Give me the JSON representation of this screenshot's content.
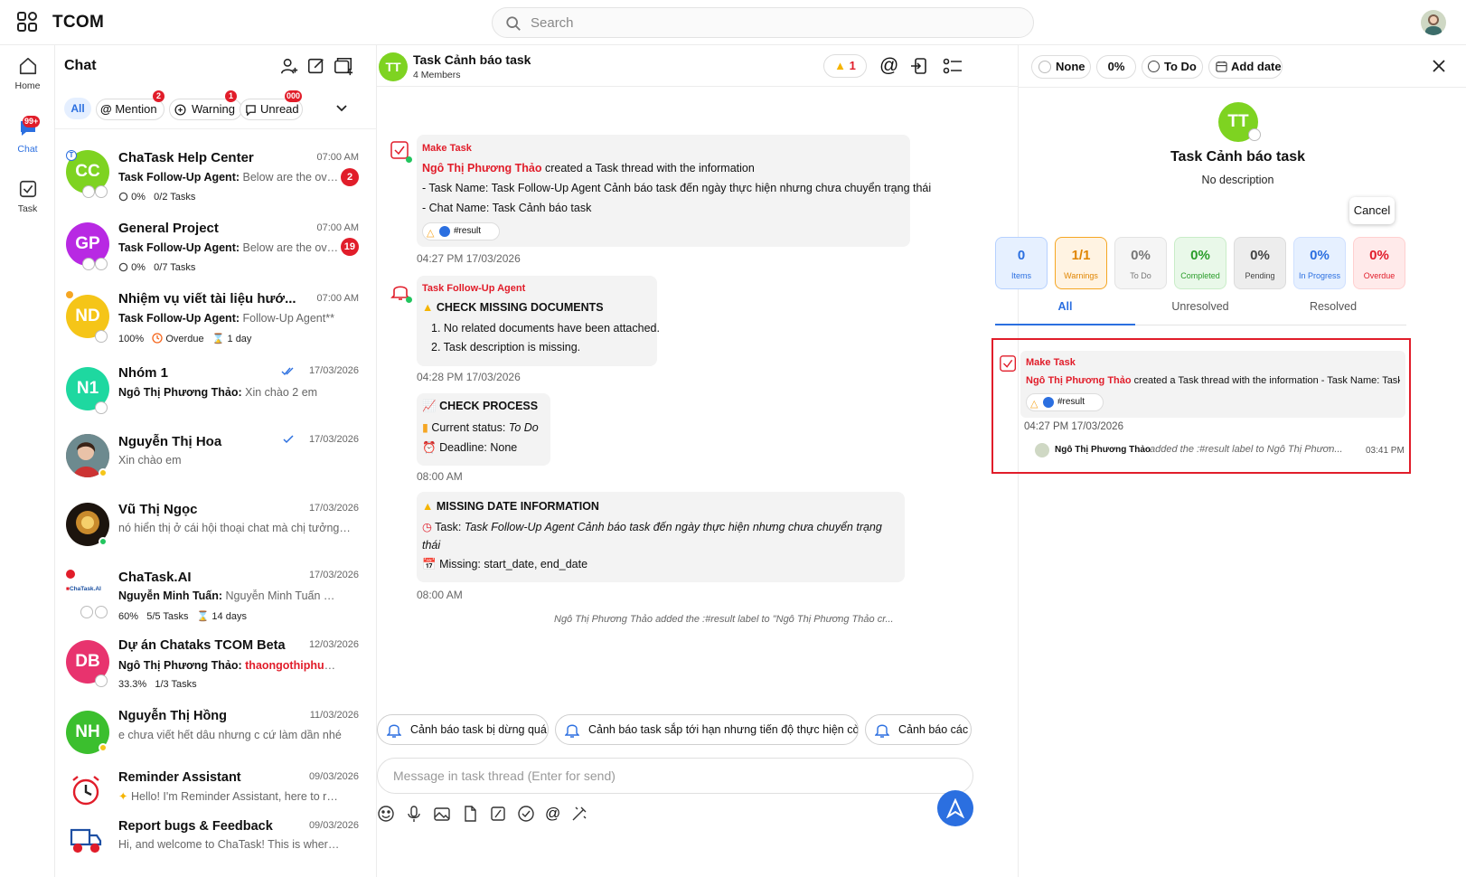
{
  "app": {
    "name": "TCOM"
  },
  "search": {
    "placeholder": "Search"
  },
  "rail": {
    "home": "Home",
    "chat": "Chat",
    "chat_badge": "99+",
    "task": "Task"
  },
  "chatlist": {
    "title": "Chat",
    "filters": {
      "all": "All",
      "mention": "Mention",
      "mention_badge": "2",
      "warning": "Warning",
      "warning_badge": "1",
      "unread": "Unread",
      "unread_badge": "000"
    },
    "items": [
      {
        "initials": "CC",
        "name": "ChaTask Help Center",
        "time": "07:00 AM",
        "sender": "Task Follow-Up Agent:",
        "preview": " Below are the over...",
        "unread": "2",
        "progress": "0%",
        "tasks": "0/2 Tasks",
        "color": "#7ed321"
      },
      {
        "initials": "GP",
        "name": "General Project",
        "time": "07:00 AM",
        "sender": "Task Follow-Up Agent:",
        "preview": " Below are the over...",
        "unread": "19",
        "progress": "0%",
        "tasks": "0/7 Tasks",
        "color": "#b829e3"
      },
      {
        "initials": "ND",
        "name": "Nhiệm vụ viết tài liệu hướ...",
        "time": "07:00 AM",
        "sender": "Task Follow-Up Agent:",
        "preview": " Follow-Up Agent**",
        "progress": "100%",
        "status": "Overdue",
        "duration": "1 day",
        "color": "#f5c518"
      },
      {
        "initials": "N1",
        "name": "Nhóm 1",
        "time": "17/03/2026",
        "sender": "Ngô Thị Phương Thảo:",
        "preview": " Xin chào 2 em",
        "color": "#1ed8a0"
      },
      {
        "name": "Nguyễn Thị Hoa",
        "time": "17/03/2026",
        "preview": "Xin chào em"
      },
      {
        "name": "Vũ Thị Ngọc",
        "time": "17/03/2026",
        "preview": "nó hiển thị ở cái hội thoại chat mà chị tưởng tác..."
      },
      {
        "name": "ChaTask.AI",
        "time": "17/03/2026",
        "sender": "Nguyễn Minh Tuấn:",
        "preview": " Nguyễn Minh Tuấn updat...",
        "progress": "60%",
        "tasks": "5/5 Tasks",
        "duration": "14 days",
        "logo_text": "ChaTask.AI"
      },
      {
        "initials": "DB",
        "name": "Dự án Chataks TCOM Beta",
        "time": "12/03/2026",
        "sender": "Ngô Thị Phương Thảo:",
        "preview_red": " thaongothiphuong@...",
        "progress": "33.3%",
        "tasks": "1/3 Tasks",
        "color": "#e8336e"
      },
      {
        "initials": "NH",
        "name": "Nguyễn Thị Hồng",
        "time": "11/03/2026",
        "preview": "e chưa viết hết dâu nhưng c cứ làm dần nhé",
        "color": "#3bbf2e"
      },
      {
        "name": "Reminder Assistant",
        "time": "09/03/2026",
        "preview": "Hello! I'm Reminder Assistant, here to remi..."
      },
      {
        "name": "Report bugs & Feedback",
        "time": "09/03/2026",
        "preview": "Hi, and welcome to ChaTask! This is where you ..."
      }
    ]
  },
  "thread": {
    "initials": "TT",
    "title": "Task Cảnh báo task",
    "members": "4 Members",
    "warning_count": "1",
    "messages": {
      "m1": {
        "sender": "Make Task",
        "author": "Ngô Thị Phương Thảo",
        "text": " created a Task thread with the information",
        "line1": "- Task Name: Task Follow-Up Agent Cảnh báo task đến ngày thực hiện nhưng chưa chuyển trạng thái",
        "line2": "- Chat Name: Task Cảnh báo task",
        "label": "#result",
        "time": "04:27 PM 17/03/2026"
      },
      "m2": {
        "sender": "Task Follow-Up Agent",
        "heading": "CHECK MISSING DOCUMENTS",
        "item1": "1. No related documents have been attached.",
        "item2": "2. Task description is missing.",
        "time": "04:28 PM 17/03/2026"
      },
      "m3": {
        "heading": "CHECK PROCESS",
        "status_label": "Current status: ",
        "status_value": "To Do",
        "deadline": "Deadline: None",
        "time": "08:00 AM"
      },
      "m4": {
        "heading": "MISSING DATE INFORMATION",
        "task_label": "Task: ",
        "task_value": "Task Follow-Up Agent Cảnh báo task đến ngày thực hiện nhưng chưa chuyển trạng",
        "task_value2": "thái",
        "missing": "Missing: start_date, end_date",
        "time": "08:00 AM"
      },
      "system": "Ngô Thị Phương Thảo added the :#result label to \"Ngô Thị Phương Thảo cr..."
    },
    "suggestions": [
      "Cảnh báo task bị dừng quá lâu",
      "Cảnh báo task sắp tới hạn nhưng tiến độ thực hiện còn thấp",
      "Cảnh báo các w"
    ],
    "composer_placeholder": "Message in task thread (Enter for send)"
  },
  "details": {
    "priority": "None",
    "progress": "0%",
    "status": "To Do",
    "add_date": "Add date",
    "initials": "TT",
    "title": "Task Cảnh báo task",
    "description": "No description",
    "cancel": "Cancel",
    "stats": [
      {
        "value": "0",
        "label": "Items"
      },
      {
        "value": "1/1",
        "label": "Warnings"
      },
      {
        "value": "0%",
        "label": "To Do"
      },
      {
        "value": "0%",
        "label": "Completed"
      },
      {
        "value": "0%",
        "label": "Pending"
      },
      {
        "value": "0%",
        "label": "In Progress"
      },
      {
        "value": "0%",
        "label": "Overdue"
      }
    ],
    "tabs": [
      "All",
      "Unresolved",
      "Resolved"
    ],
    "card": {
      "sender": "Make Task",
      "author": "Ngô Thị Phương Thảo",
      "text": " created a Task thread with the information - Task Name: Task Follow...",
      "label": "#result",
      "time": "04:27 PM 17/03/2026",
      "activity_author": "Ngô Thị Phương Thảo",
      "activity_text": "added the :#result label to Ngô Thị Phươn...",
      "activity_time": "03:41 PM"
    }
  }
}
